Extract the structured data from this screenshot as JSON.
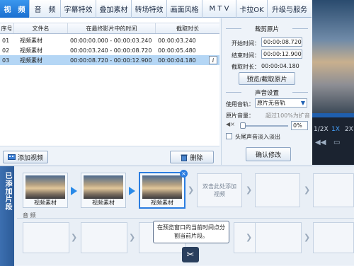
{
  "menu": {
    "items": [
      "视　频",
      "音　频",
      "字幕特效",
      "叠加素材",
      "转场特效",
      "画面风格",
      "M T V",
      "卡拉OK",
      "升级与服务"
    ]
  },
  "table": {
    "headers": [
      "序号",
      "文件名",
      "在最终影片中的时间",
      "截取时长"
    ],
    "rows": [
      {
        "no": "01",
        "name": "视频素材",
        "time": "00:00:00.000 - 00:00:03.240",
        "dur": "00:00:03.240"
      },
      {
        "no": "02",
        "name": "视频素材",
        "time": "00:00:03.240 - 00:00:08.720",
        "dur": "00:00:05.480"
      },
      {
        "no": "03",
        "name": "视频素材",
        "time": "00:00:08.720 - 00:00:12.900",
        "dur": "00:00:04.180"
      }
    ],
    "info_icon": "i",
    "add_button": "添加视频",
    "delete_button": "删除"
  },
  "settings": {
    "cut_title": "裁剪原片",
    "start_label": "开始时间：",
    "start_value": "00:00:08.720",
    "end_label": "结束时间：",
    "end_value": "00:00:12.900",
    "dur_label": "截取时长：",
    "dur_value": "00:00:04.180",
    "preview_button": "预览/截取原片",
    "sound_title": "声音设置",
    "track_label": "使用音轨：",
    "track_value": "原片无音轨",
    "volume_label": "原片音量：",
    "volume_hint": "超过100%为扩音",
    "volume_value": "0%",
    "fade_label": "头尾声音淡入淡出",
    "confirm_button": "确认修改"
  },
  "preview": {
    "zoom_options": [
      "1/2X",
      "1X",
      "2X"
    ],
    "zoom_selected": "1X"
  },
  "timeline": {
    "added_tab": "已添加片段",
    "clips": [
      "视频素材",
      "视频素材",
      "视频素材"
    ],
    "empty_slot": "双击此处添加视频",
    "audio_label": "音 频",
    "tooltip": "在预览窗口的当前时间点分割当前片段。"
  },
  "colors": {
    "accent": "#1a6fd0",
    "selected_row": "#b4d6f5",
    "timeline_tab": "#2c5b98"
  }
}
